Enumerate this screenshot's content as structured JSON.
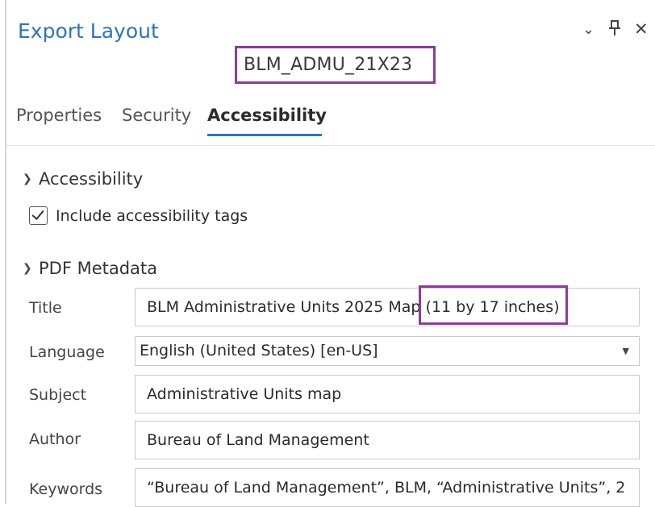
{
  "window": {
    "title": "Export Layout",
    "controls": {
      "options_icon": "chevron-down-icon",
      "pin_icon": "pin-icon",
      "close_icon": "close-icon"
    }
  },
  "layout_name": "BLM_ADMU_21X23",
  "tabs": [
    {
      "label": "Properties",
      "active": false
    },
    {
      "label": "Security",
      "active": false
    },
    {
      "label": "Accessibility",
      "active": true
    }
  ],
  "accessibility_section": {
    "heading": "Accessibility",
    "include_tags": {
      "label": "Include accessibility tags",
      "checked": true
    }
  },
  "pdf_metadata": {
    "heading": "PDF Metadata",
    "fields": {
      "title": {
        "label": "Title",
        "value": "BLM Administrative Units 2025 Map (11 by 17 inches)"
      },
      "language": {
        "label": "Language",
        "value": "English (United States) [en-US]"
      },
      "subject": {
        "label": "Subject",
        "value": "Administrative Units map"
      },
      "author": {
        "label": "Author",
        "value": "Bureau of Land Management"
      },
      "keywords": {
        "label": "Keywords",
        "value": "“Bureau of Land Management”, BLM, “Administrative Units”, 2"
      }
    }
  },
  "colors": {
    "title_blue": "#2e75b6",
    "highlight_purple": "#8e3b9a"
  }
}
